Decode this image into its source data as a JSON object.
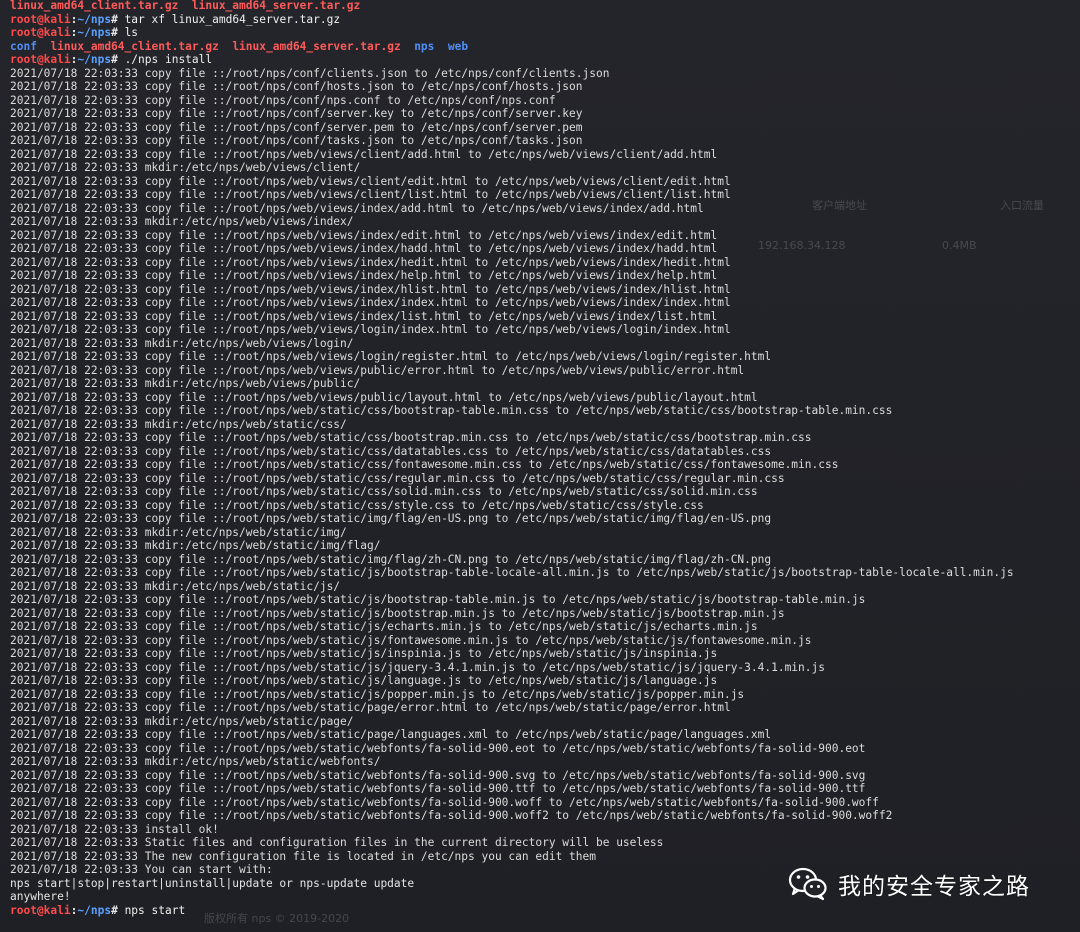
{
  "terminal": {
    "header_files": [
      "linux_amd64_client.tar.gz",
      "linux_amd64_server.tar.gz"
    ],
    "prompt": {
      "user_host": "root@kali",
      "path": "~/nps",
      "symbol": "#"
    },
    "commands": {
      "extract": "tar xf linux_amd64_server.tar.gz",
      "list": "ls",
      "install": "./nps install",
      "start": "nps start"
    },
    "ls_output": [
      {
        "name": "conf",
        "type": "dir"
      },
      {
        "name": "linux_amd64_client.tar.gz",
        "type": "archive"
      },
      {
        "name": "linux_amd64_server.tar.gz",
        "type": "archive"
      },
      {
        "name": "nps",
        "type": "dir"
      },
      {
        "name": "web",
        "type": "dir"
      }
    ],
    "log_lines": [
      "2021/07/18 22:03:33 copy file ::/root/nps/conf/clients.json to /etc/nps/conf/clients.json",
      "2021/07/18 22:03:33 copy file ::/root/nps/conf/hosts.json to /etc/nps/conf/hosts.json",
      "2021/07/18 22:03:33 copy file ::/root/nps/conf/nps.conf to /etc/nps/conf/nps.conf",
      "2021/07/18 22:03:33 copy file ::/root/nps/conf/server.key to /etc/nps/conf/server.key",
      "2021/07/18 22:03:33 copy file ::/root/nps/conf/server.pem to /etc/nps/conf/server.pem",
      "2021/07/18 22:03:33 copy file ::/root/nps/conf/tasks.json to /etc/nps/conf/tasks.json",
      "2021/07/18 22:03:33 copy file ::/root/nps/web/views/client/add.html to /etc/nps/web/views/client/add.html",
      "2021/07/18 22:03:33 mkdir:/etc/nps/web/views/client/",
      "2021/07/18 22:03:33 copy file ::/root/nps/web/views/client/edit.html to /etc/nps/web/views/client/edit.html",
      "2021/07/18 22:03:33 copy file ::/root/nps/web/views/client/list.html to /etc/nps/web/views/client/list.html",
      "2021/07/18 22:03:33 copy file ::/root/nps/web/views/index/add.html to /etc/nps/web/views/index/add.html",
      "2021/07/18 22:03:33 mkdir:/etc/nps/web/views/index/",
      "2021/07/18 22:03:33 copy file ::/root/nps/web/views/index/edit.html to /etc/nps/web/views/index/edit.html",
      "2021/07/18 22:03:33 copy file ::/root/nps/web/views/index/hadd.html to /etc/nps/web/views/index/hadd.html",
      "2021/07/18 22:03:33 copy file ::/root/nps/web/views/index/hedit.html to /etc/nps/web/views/index/hedit.html",
      "2021/07/18 22:03:33 copy file ::/root/nps/web/views/index/help.html to /etc/nps/web/views/index/help.html",
      "2021/07/18 22:03:33 copy file ::/root/nps/web/views/index/hlist.html to /etc/nps/web/views/index/hlist.html",
      "2021/07/18 22:03:33 copy file ::/root/nps/web/views/index/index.html to /etc/nps/web/views/index/index.html",
      "2021/07/18 22:03:33 copy file ::/root/nps/web/views/index/list.html to /etc/nps/web/views/index/list.html",
      "2021/07/18 22:03:33 copy file ::/root/nps/web/views/login/index.html to /etc/nps/web/views/login/index.html",
      "2021/07/18 22:03:33 mkdir:/etc/nps/web/views/login/",
      "2021/07/18 22:03:33 copy file ::/root/nps/web/views/login/register.html to /etc/nps/web/views/login/register.html",
      "2021/07/18 22:03:33 copy file ::/root/nps/web/views/public/error.html to /etc/nps/web/views/public/error.html",
      "2021/07/18 22:03:33 mkdir:/etc/nps/web/views/public/",
      "2021/07/18 22:03:33 copy file ::/root/nps/web/views/public/layout.html to /etc/nps/web/views/public/layout.html",
      "2021/07/18 22:03:33 copy file ::/root/nps/web/static/css/bootstrap-table.min.css to /etc/nps/web/static/css/bootstrap-table.min.css",
      "2021/07/18 22:03:33 mkdir:/etc/nps/web/static/css/",
      "2021/07/18 22:03:33 copy file ::/root/nps/web/static/css/bootstrap.min.css to /etc/nps/web/static/css/bootstrap.min.css",
      "2021/07/18 22:03:33 copy file ::/root/nps/web/static/css/datatables.css to /etc/nps/web/static/css/datatables.css",
      "2021/07/18 22:03:33 copy file ::/root/nps/web/static/css/fontawesome.min.css to /etc/nps/web/static/css/fontawesome.min.css",
      "2021/07/18 22:03:33 copy file ::/root/nps/web/static/css/regular.min.css to /etc/nps/web/static/css/regular.min.css",
      "2021/07/18 22:03:33 copy file ::/root/nps/web/static/css/solid.min.css to /etc/nps/web/static/css/solid.min.css",
      "2021/07/18 22:03:33 copy file ::/root/nps/web/static/css/style.css to /etc/nps/web/static/css/style.css",
      "2021/07/18 22:03:33 copy file ::/root/nps/web/static/img/flag/en-US.png to /etc/nps/web/static/img/flag/en-US.png",
      "2021/07/18 22:03:33 mkdir:/etc/nps/web/static/img/",
      "2021/07/18 22:03:33 mkdir:/etc/nps/web/static/img/flag/",
      "2021/07/18 22:03:33 copy file ::/root/nps/web/static/img/flag/zh-CN.png to /etc/nps/web/static/img/flag/zh-CN.png",
      "2021/07/18 22:03:33 copy file ::/root/nps/web/static/js/bootstrap-table-locale-all.min.js to /etc/nps/web/static/js/bootstrap-table-locale-all.min.js",
      "2021/07/18 22:03:33 mkdir:/etc/nps/web/static/js/",
      "2021/07/18 22:03:33 copy file ::/root/nps/web/static/js/bootstrap-table.min.js to /etc/nps/web/static/js/bootstrap-table.min.js",
      "2021/07/18 22:03:33 copy file ::/root/nps/web/static/js/bootstrap.min.js to /etc/nps/web/static/js/bootstrap.min.js",
      "2021/07/18 22:03:33 copy file ::/root/nps/web/static/js/echarts.min.js to /etc/nps/web/static/js/echarts.min.js",
      "2021/07/18 22:03:33 copy file ::/root/nps/web/static/js/fontawesome.min.js to /etc/nps/web/static/js/fontawesome.min.js",
      "2021/07/18 22:03:33 copy file ::/root/nps/web/static/js/inspinia.js to /etc/nps/web/static/js/inspinia.js",
      "2021/07/18 22:03:33 copy file ::/root/nps/web/static/js/jquery-3.4.1.min.js to /etc/nps/web/static/js/jquery-3.4.1.min.js",
      "2021/07/18 22:03:33 copy file ::/root/nps/web/static/js/language.js to /etc/nps/web/static/js/language.js",
      "2021/07/18 22:03:33 copy file ::/root/nps/web/static/js/popper.min.js to /etc/nps/web/static/js/popper.min.js",
      "2021/07/18 22:03:33 copy file ::/root/nps/web/static/page/error.html to /etc/nps/web/static/page/error.html",
      "2021/07/18 22:03:33 mkdir:/etc/nps/web/static/page/",
      "2021/07/18 22:03:33 copy file ::/root/nps/web/static/page/languages.xml to /etc/nps/web/static/page/languages.xml",
      "2021/07/18 22:03:33 copy file ::/root/nps/web/static/webfonts/fa-solid-900.eot to /etc/nps/web/static/webfonts/fa-solid-900.eot",
      "2021/07/18 22:03:33 mkdir:/etc/nps/web/static/webfonts/",
      "2021/07/18 22:03:33 copy file ::/root/nps/web/static/webfonts/fa-solid-900.svg to /etc/nps/web/static/webfonts/fa-solid-900.svg",
      "2021/07/18 22:03:33 copy file ::/root/nps/web/static/webfonts/fa-solid-900.ttf to /etc/nps/web/static/webfonts/fa-solid-900.ttf",
      "2021/07/18 22:03:33 copy file ::/root/nps/web/static/webfonts/fa-solid-900.woff to /etc/nps/web/static/webfonts/fa-solid-900.woff",
      "2021/07/18 22:03:33 copy file ::/root/nps/web/static/webfonts/fa-solid-900.woff2 to /etc/nps/web/static/webfonts/fa-solid-900.woff2",
      "2021/07/18 22:03:33 install ok!",
      "2021/07/18 22:03:33 Static files and configuration files in the current directory will be useless",
      "2021/07/18 22:03:33 The new configuration file is located in /etc/nps you can edit them",
      "2021/07/18 22:03:33 You can start with:"
    ],
    "usage_line": "nps start|stop|restart|uninstall|update or nps-update update",
    "tail_line": "anywhere!"
  },
  "background_ghost": {
    "label_client_addr": "客户端地址",
    "label_inflow": "入口流量",
    "ghost_ip": "192.168.34.128",
    "ghost_flow": "0.4MB",
    "ghost_footer": "版权所有 nps © 2019-2020"
  },
  "watermark": {
    "text": "我的安全专家之路",
    "icon": "wechat-icon"
  },
  "colors": {
    "background": "#212227",
    "text": "#dcdcdc",
    "prompt_user": "#ff4b4b",
    "prompt_path": "#5aa0ff",
    "dir": "#4f8ef7",
    "archive": "#ff5a5a"
  }
}
